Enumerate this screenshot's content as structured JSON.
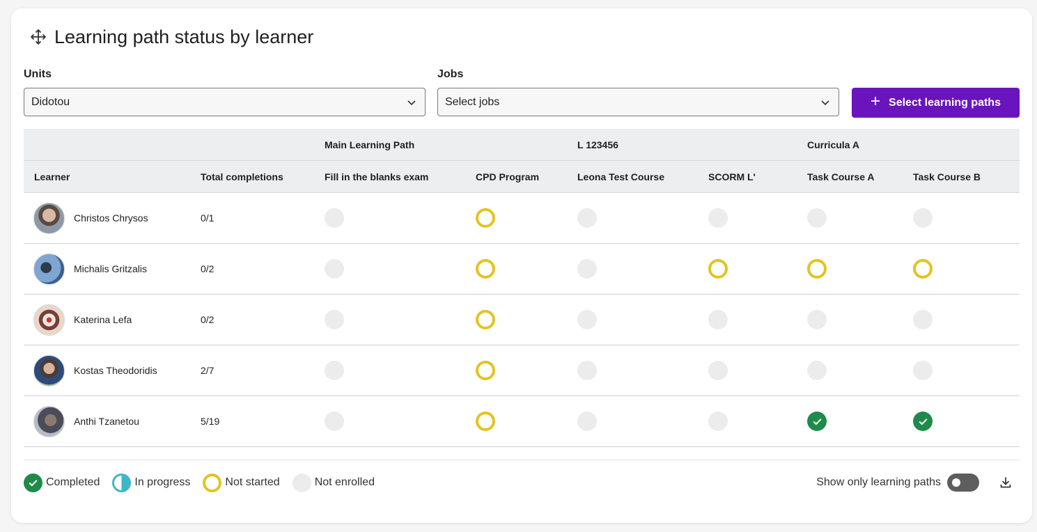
{
  "header": {
    "title": "Learning path status by learner"
  },
  "filters": {
    "units_label": "Units",
    "units_value": "Didotou",
    "jobs_label": "Jobs",
    "jobs_placeholder": "Select jobs",
    "select_paths_button": "Select learning paths"
  },
  "table": {
    "groups": [
      "Main Learning Path",
      "L 123456",
      "Curricula A"
    ],
    "columns": [
      "Learner",
      "Total completions",
      "Fill in the blanks exam",
      "CPD Program",
      "Leona Test Course",
      "SCORM L'",
      "Task Course A",
      "Task Course B"
    ],
    "rows": [
      {
        "name": "Christos Chrysos",
        "total": "0/1",
        "statuses": [
          "not-enrolled",
          "not-started",
          "not-enrolled",
          "not-enrolled",
          "not-enrolled",
          "not-enrolled"
        ]
      },
      {
        "name": "Michalis Gritzalis",
        "total": "0/2",
        "statuses": [
          "not-enrolled",
          "not-started",
          "not-enrolled",
          "not-started",
          "not-started",
          "not-started"
        ]
      },
      {
        "name": "Katerina Lefa",
        "total": "0/2",
        "statuses": [
          "not-enrolled",
          "not-started",
          "not-enrolled",
          "not-enrolled",
          "not-enrolled",
          "not-enrolled"
        ]
      },
      {
        "name": "Kostas Theodoridis",
        "total": "2/7",
        "statuses": [
          "not-enrolled",
          "not-started",
          "not-enrolled",
          "not-enrolled",
          "not-enrolled",
          "not-enrolled"
        ]
      },
      {
        "name": "Anthi Tzanetou",
        "total": "5/19",
        "statuses": [
          "not-enrolled",
          "not-started",
          "not-enrolled",
          "not-enrolled",
          "completed",
          "completed"
        ]
      }
    ]
  },
  "legend": {
    "completed": "Completed",
    "in_progress": "In progress",
    "not_started": "Not started",
    "not_enrolled": "Not enrolled"
  },
  "tools": {
    "toggle_label": "Show only learning paths",
    "toggle_on": false
  },
  "colors": {
    "accent": "#6a14bd",
    "completed": "#1e8b4a",
    "not_started": "#e3c421",
    "in_progress": "#3fb6c8",
    "not_enrolled": "#ececec"
  }
}
